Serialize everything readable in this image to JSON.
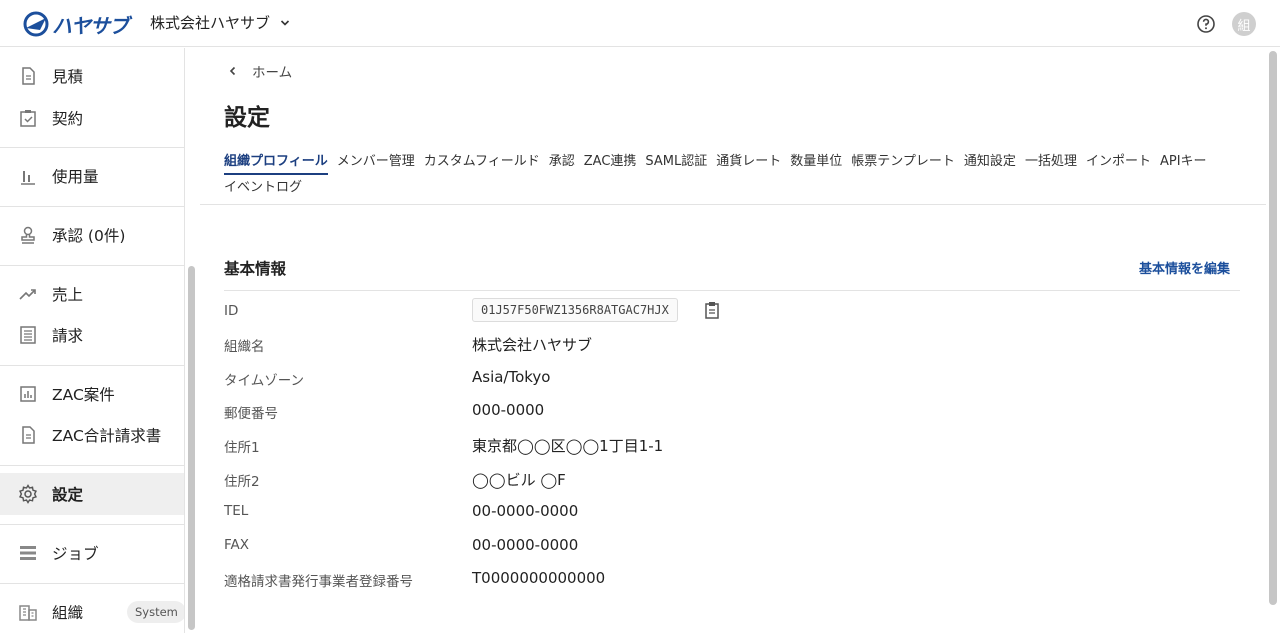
{
  "header": {
    "logo_text": "ハヤサブ",
    "org_name": "株式会社ハヤサブ",
    "avatar_initial": "組",
    "brand_color": "#1c4f9c"
  },
  "sidebar": {
    "items": [
      {
        "label": "見積",
        "icon": "document-icon"
      },
      {
        "label": "契約",
        "icon": "clipboard-check-icon"
      },
      {
        "label": "使用量",
        "icon": "bar-chart-icon"
      },
      {
        "label": "承認 (0件)",
        "icon": "stamp-icon"
      },
      {
        "label": "売上",
        "icon": "trending-up-icon"
      },
      {
        "label": "請求",
        "icon": "list-doc-icon"
      },
      {
        "label": "ZAC案件",
        "icon": "chart-box-icon"
      },
      {
        "label": "ZAC合計請求書",
        "icon": "document-icon"
      },
      {
        "label": "設定",
        "icon": "gear-icon",
        "active": true
      },
      {
        "label": "ジョブ",
        "icon": "stack-icon"
      },
      {
        "label": "組織",
        "icon": "building-icon",
        "badge": "System"
      }
    ]
  },
  "main": {
    "breadcrumb": "ホーム",
    "title": "設定",
    "tabs": [
      {
        "label": "組織プロフィール",
        "active": true
      },
      {
        "label": "メンバー管理"
      },
      {
        "label": "カスタムフィールド"
      },
      {
        "label": "承認"
      },
      {
        "label": "ZAC連携"
      },
      {
        "label": "SAML認証"
      },
      {
        "label": "通貨レート"
      },
      {
        "label": "数量単位"
      },
      {
        "label": "帳票テンプレート"
      },
      {
        "label": "通知設定"
      },
      {
        "label": "一括処理"
      },
      {
        "label": "インポート"
      },
      {
        "label": "APIキー"
      },
      {
        "label": "イベントログ"
      }
    ],
    "section_title": "基本情報",
    "edit_link": "基本情報を編集",
    "fields": [
      {
        "label": "ID",
        "value": "01J57F50FWZ1356R8ATGAC7HJX"
      },
      {
        "label": "組織名",
        "value": "株式会社ハヤサブ"
      },
      {
        "label": "タイムゾーン",
        "value": "Asia/Tokyo"
      },
      {
        "label": "郵便番号",
        "value": "000-0000"
      },
      {
        "label": "住所1",
        "value": "東京都◯◯区◯◯1丁目1-1"
      },
      {
        "label": "住所2",
        "value": "◯◯ビル ◯F"
      },
      {
        "label": "TEL",
        "value": "00-0000-0000"
      },
      {
        "label": "FAX",
        "value": "00-0000-0000"
      },
      {
        "label": "適格請求書発行事業者登録番号",
        "value": "T0000000000000"
      }
    ]
  }
}
